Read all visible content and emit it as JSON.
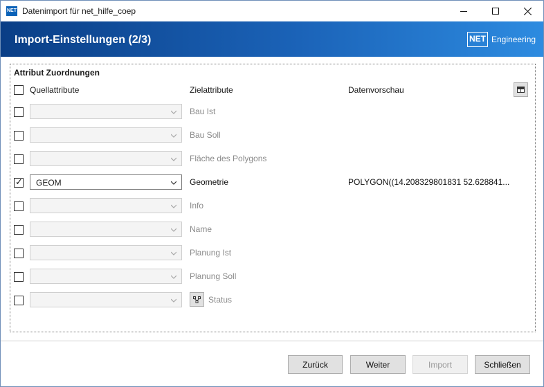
{
  "window": {
    "app_icon_text": "NET",
    "title": "Datenimport für net_hilfe_coep"
  },
  "header": {
    "title": "Import-Einstellungen (2/3)",
    "logo_box": "NET",
    "logo_text": "Engineering"
  },
  "group": {
    "label": "Attribut Zuordnungen",
    "col_quell": "Quellattribute",
    "col_ziel": "Zielattribute",
    "col_vorschau": "Datenvorschau"
  },
  "rows": [
    {
      "checked": false,
      "quell": "",
      "ziel": "Bau Ist",
      "preview": ""
    },
    {
      "checked": false,
      "quell": "",
      "ziel": "Bau Soll",
      "preview": ""
    },
    {
      "checked": false,
      "quell": "",
      "ziel": "Fläche des Polygons",
      "preview": ""
    },
    {
      "checked": true,
      "quell": "GEOM",
      "ziel": "Geometrie",
      "preview": "POLYGON((14.208329801831 52.628841..."
    },
    {
      "checked": false,
      "quell": "",
      "ziel": "Info",
      "preview": ""
    },
    {
      "checked": false,
      "quell": "",
      "ziel": "Name",
      "preview": ""
    },
    {
      "checked": false,
      "quell": "",
      "ziel": "Planung Ist",
      "preview": ""
    },
    {
      "checked": false,
      "quell": "",
      "ziel": "Planung Soll",
      "preview": ""
    },
    {
      "checked": false,
      "quell": "",
      "ziel": "Status",
      "preview": ""
    }
  ],
  "buttons": {
    "back": "Zurück",
    "next": "Weiter",
    "import": "Import",
    "close": "Schließen"
  }
}
